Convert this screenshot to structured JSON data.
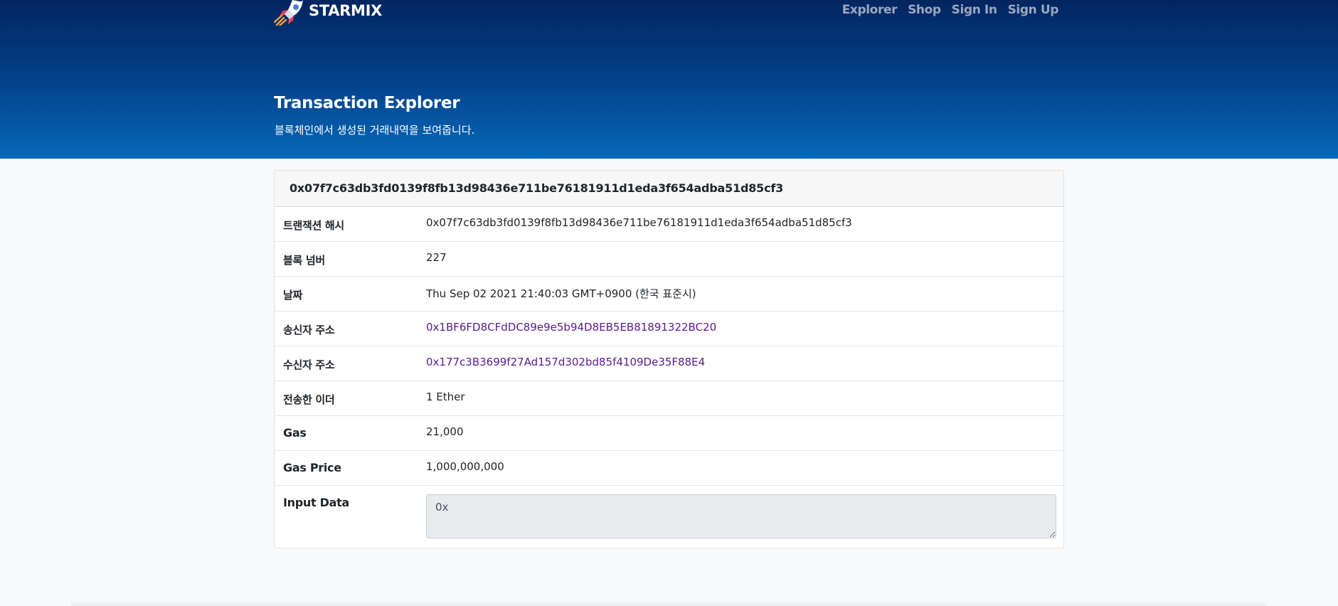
{
  "nav": {
    "brand": "STARMIX",
    "links": [
      "Explorer",
      "Shop",
      "Sign In",
      "Sign Up"
    ]
  },
  "hero": {
    "title": "Transaction Explorer",
    "subtitle": "블록체인에서 생성된 거래내역을 보여줍니다."
  },
  "card": {
    "header": "0x07f7c63db3fd0139f8fb13d98436e711be76181911d1eda3f654adba51d85cf3",
    "rows": [
      {
        "label": "트랜잭션 해시",
        "value": "0x07f7c63db3fd0139f8fb13d98436e711be76181911d1eda3f654adba51d85cf3"
      },
      {
        "label": "블록 넘버",
        "value": "227"
      },
      {
        "label": "날짜",
        "value": "Thu Sep 02 2021 21:40:03 GMT+0900 (한국 표준시)"
      },
      {
        "label": "송신자 주소",
        "value": "0x1BF6FD8CFdDC89e9e5b94D8EB5EB81891322BC20"
      },
      {
        "label": "수신자 주소",
        "value": "0x177c3B3699f27Ad157d302bd85f4109De35F88E4"
      },
      {
        "label": "전송한 이더",
        "value": "1 Ether"
      },
      {
        "label": "Gas",
        "value": "21,000"
      },
      {
        "label": "Gas Price",
        "value": "1,000,000,000"
      },
      {
        "label": "Input Data",
        "value": "0x"
      }
    ]
  },
  "colors": {
    "hero_top": "#03255f",
    "hero_bottom": "#0669b8",
    "link": "#5a1a8c",
    "nav_link": "#9aa7c0"
  }
}
